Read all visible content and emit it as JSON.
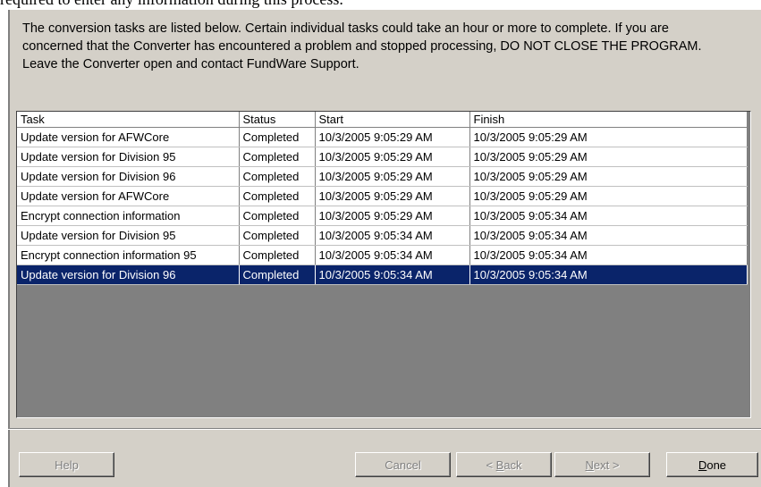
{
  "top_fragment": "required to enter any information during this process.",
  "intro_text": "The conversion tasks are listed below. Certain individual tasks could take an hour or more to complete.  If you are concerned that the Converter has encountered a problem and stopped processing, DO NOT CLOSE THE PROGRAM.  Leave the Converter open and contact FundWare Support.",
  "table": {
    "columns": [
      "Task",
      "Status",
      "Start",
      "Finish"
    ],
    "rows": [
      [
        "Update version for AFWCore",
        "Completed",
        "10/3/2005 9:05:29 AM",
        "10/3/2005 9:05:29 AM"
      ],
      [
        "Update version for Division 95",
        "Completed",
        "10/3/2005 9:05:29 AM",
        "10/3/2005 9:05:29 AM"
      ],
      [
        "Update version for Division 96",
        "Completed",
        "10/3/2005 9:05:29 AM",
        "10/3/2005 9:05:29 AM"
      ],
      [
        "Update version for AFWCore",
        "Completed",
        "10/3/2005 9:05:29 AM",
        "10/3/2005 9:05:29 AM"
      ],
      [
        "Encrypt connection information",
        "Completed",
        "10/3/2005 9:05:29 AM",
        "10/3/2005 9:05:34 AM"
      ],
      [
        "Update version for Division 95",
        "Completed",
        "10/3/2005 9:05:34 AM",
        "10/3/2005 9:05:34 AM"
      ],
      [
        "Encrypt connection information 95",
        "Completed",
        "10/3/2005 9:05:34 AM",
        "10/3/2005 9:05:34 AM"
      ],
      [
        "Update version for Division 96",
        "Completed",
        "10/3/2005 9:05:34 AM",
        "10/3/2005 9:05:34 AM"
      ]
    ],
    "selected_row": 7
  },
  "buttons": {
    "help": "Help",
    "cancel": "Cancel",
    "back_prefix": "< ",
    "back_key": "B",
    "back_rest": "ack",
    "next_key": "N",
    "next_rest": "ext >",
    "done_key": "D",
    "done_rest": "one"
  },
  "colors": {
    "dialog_bg": "#d4d0c8",
    "grid_empty_bg": "#808080",
    "selection_bg": "#0a246a",
    "selection_text": "#ffffff"
  }
}
